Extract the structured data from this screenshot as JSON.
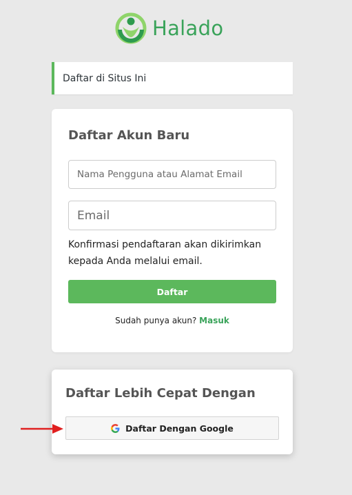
{
  "brand": {
    "name": "Halado",
    "color": "#3aa35a",
    "logo_icon": "halado-logo-icon"
  },
  "notice": {
    "text": "Daftar di Situs Ini"
  },
  "register": {
    "title": "Daftar Akun Baru",
    "username_placeholder": "Nama Pengguna atau Alamat Email",
    "email_placeholder": "Email",
    "confirmation_note": "Konfirmasi pendaftaran akan dikirimkan kepada Anda melalui email.",
    "submit_label": "Daftar",
    "login_prompt": "Sudah punya akun?",
    "login_link": "Masuk"
  },
  "social": {
    "title": "Daftar Lebih Cepat Dengan",
    "google_label": "Daftar Dengan Google",
    "google_icon": "google-icon"
  },
  "annotation": {
    "arrow_color": "#e02020",
    "icon": "red-arrow-icon"
  },
  "colors": {
    "accent": "#5cb85c",
    "background": "#e9e9e9"
  }
}
